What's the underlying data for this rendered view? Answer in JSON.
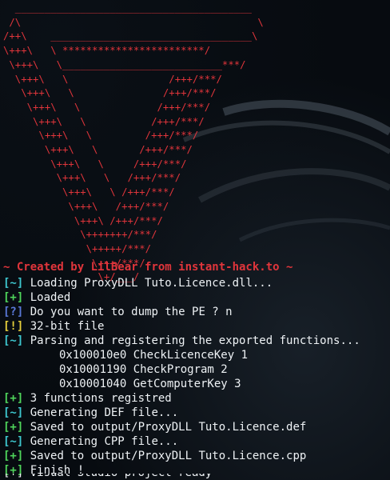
{
  "banner": {
    "ascii": [
      "  ________________________________________",
      " /\\                                        \\",
      "/++\\    __________________________________\\",
      "\\+++\\   \\ ************************/",
      " \\+++\\   \\___________________________***/",
      "  \\+++\\   \\                 /+++/***/",
      "   \\+++\\   \\               /+++/***/",
      "    \\+++\\   \\             /+++/***/",
      "     \\+++\\   \\           /+++/***/",
      "      \\+++\\   \\         /+++/***/",
      "       \\+++\\   \\       /+++/***/",
      "        \\+++\\   \\     /+++/***/",
      "         \\+++\\   \\   /+++/***/",
      "          \\+++\\   \\ /+++/***/",
      "           \\+++\\   /+++/***/",
      "            \\+++\\ /+++/***/",
      "             \\+++++++/***/",
      "              \\+++++/***/",
      "               \\+++/***/",
      "                \\+/___/"
    ],
    "credit": "~ Created by LilBear from instant-hack.to ~"
  },
  "log": [
    {
      "prefix": "[~]",
      "kind": "info",
      "text": "Loading ProxyDLL Tuto.Licence.dll..."
    },
    {
      "prefix": "[+]",
      "kind": "ok",
      "text": "Loaded"
    },
    {
      "prefix": "[?]",
      "kind": "ask",
      "text": "Do you want to dump the PE ? n"
    },
    {
      "prefix": "[!]",
      "kind": "warn",
      "text": "32-bit file"
    },
    {
      "prefix": "[~]",
      "kind": "info",
      "text": "Parsing and registering the exported functions..."
    },
    {
      "prefix": "",
      "kind": "func",
      "text": "0x100010e0 CheckLicenceKey 1"
    },
    {
      "prefix": "",
      "kind": "func",
      "text": "0x10001190 CheckProgram 2"
    },
    {
      "prefix": "",
      "kind": "func",
      "text": "0x10001040 GetComputerKey 3"
    },
    {
      "prefix": "[+]",
      "kind": "ok",
      "text": "3 functions registred"
    },
    {
      "prefix": "[~]",
      "kind": "info",
      "text": "Generating DEF file..."
    },
    {
      "prefix": "[+]",
      "kind": "ok",
      "text": "Saved to output/ProxyDLL Tuto.Licence.def"
    },
    {
      "prefix": "[~]",
      "kind": "info",
      "text": "Generating CPP file..."
    },
    {
      "prefix": "[+]",
      "kind": "ok",
      "text": "Saved to output/ProxyDLL Tuto.Licence.cpp"
    },
    {
      "prefix": "[+]",
      "kind": "ok",
      "text": "Finish !"
    }
  ],
  "partial_line": "[+] Visual Studio project ready"
}
